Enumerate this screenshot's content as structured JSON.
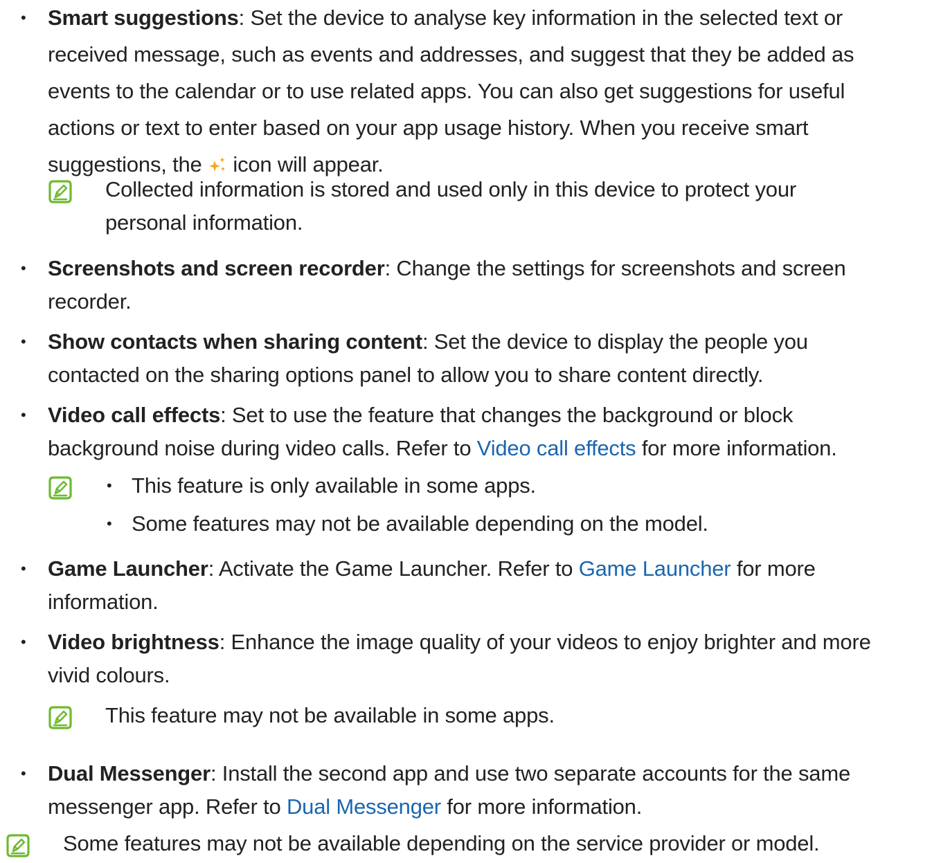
{
  "colors": {
    "text": "#222222",
    "link": "#1a66b0",
    "note_icon": "#6dbb2f",
    "spark": "#f5a623"
  },
  "items": {
    "smart_suggestions": {
      "title": "Smart suggestions",
      "lines": [
        ": Set the device to analyse key information in the selected text or",
        "received message, such as events and addresses, and suggest that they be added as",
        "events to the calendar or to use related apps. You can also get suggestions for useful",
        "actions or text to enter based on your app usage history. When you receive smart"
      ],
      "last_before_icon": "suggestions, the ",
      "icon": "sparkle-icon",
      "last_after_icon": " icon will appear.",
      "note": [
        "Collected information is stored and used only in this device to protect your",
        "personal information."
      ]
    },
    "screenshots": {
      "title": "Screenshots and screen recorder",
      "lines": [
        ": Change the settings for screenshots and screen",
        "recorder."
      ]
    },
    "show_contacts": {
      "title": "Show contacts when sharing content",
      "lines": [
        ": Set the device to display the people you",
        "contacted on the sharing options panel to allow you to share content directly."
      ]
    },
    "video_call_effects": {
      "title": "Video call effects",
      "line1": ": Set to use the feature that changes the background or block",
      "line2_before": "background noise during video calls. Refer to ",
      "line2_link": "Video call effects",
      "line2_after": " for more information.",
      "note_bullets": [
        "This feature is only available in some apps.",
        "Some features may not be available depending on the model."
      ]
    },
    "game_launcher": {
      "title": "Game Launcher",
      "line1_before": ": Activate the Game Launcher. Refer to ",
      "line1_link": "Game Launcher",
      "line1_after": " for more",
      "line2": "information."
    },
    "video_brightness": {
      "title": "Video brightness",
      "lines": [
        ": Enhance the image quality of your videos to enjoy brighter and more",
        "vivid colours."
      ],
      "note": "This feature may not be available in some apps."
    },
    "dual_messenger": {
      "title": "Dual Messenger",
      "line1": ": Install the second app and use two separate accounts for the same",
      "line2_before": "messenger app. Refer to ",
      "line2_link": "Dual Messenger",
      "line2_after": " for more information."
    }
  },
  "footer_note": "Some features may not be available depending on the service provider or model."
}
